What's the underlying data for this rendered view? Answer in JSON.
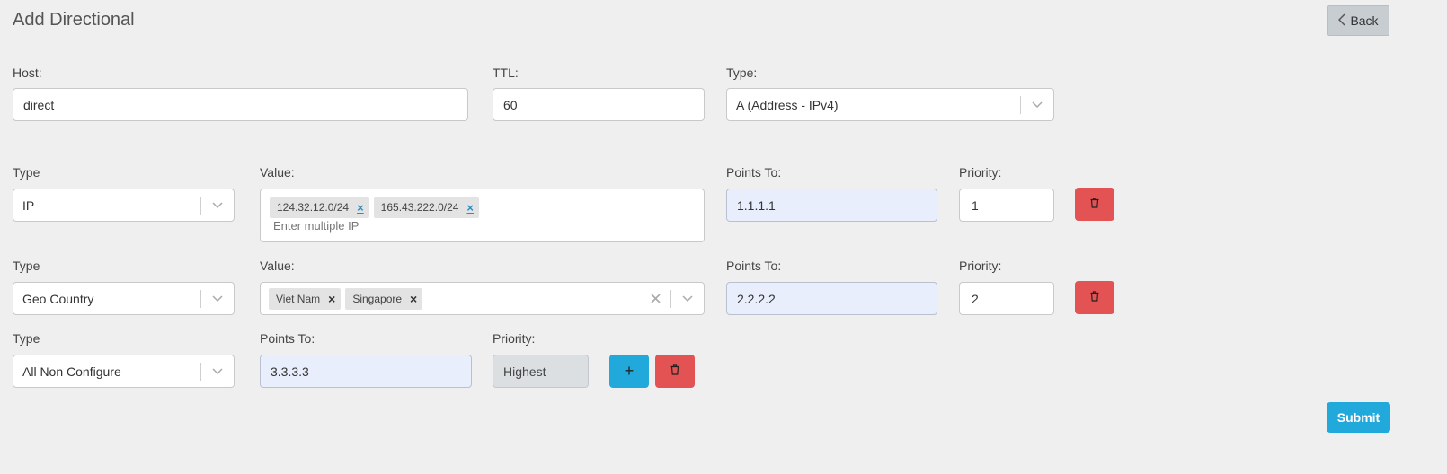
{
  "page": {
    "title": "Add Directional",
    "back_label": "Back"
  },
  "colors": {
    "primary": "#21a9db",
    "danger": "#e35353",
    "back_bg": "#c8cdd2"
  },
  "record": {
    "host_label": "Host:",
    "host_value": "direct",
    "ttl_label": "TTL:",
    "ttl_value": "60",
    "type_label": "Type:",
    "type_value": "A (Address - IPv4)"
  },
  "rules": [
    {
      "type_label": "Type",
      "type_value": "IP",
      "value_label": "Value:",
      "tags": [
        "124.32.12.0/24",
        "165.43.222.0/24"
      ],
      "tag_remove": "×",
      "value_placeholder": "Enter multiple IP",
      "points_label": "Points To:",
      "points_value": "1.1.1.1",
      "priority_label": "Priority:",
      "priority_value": "1"
    },
    {
      "type_label": "Type",
      "type_value": "Geo Country",
      "value_label": "Value:",
      "tags": [
        "Viet Nam",
        "Singapore"
      ],
      "tag_remove": "×",
      "points_label": "Points To:",
      "points_value": "2.2.2.2",
      "priority_label": "Priority:",
      "priority_value": "2"
    },
    {
      "type_label": "Type",
      "type_value": "All Non Configure",
      "points_label": "Points To:",
      "points_value": "3.3.3.3",
      "priority_label": "Priority:",
      "priority_value": "Highest",
      "add_label": "+"
    }
  ],
  "form": {
    "submit_label": "Submit"
  },
  "icons": {
    "back": "chevron-left-icon",
    "chevron": "chevron-down-icon",
    "delete": "trash-icon",
    "clear": "close-icon",
    "add": "plus-icon"
  }
}
